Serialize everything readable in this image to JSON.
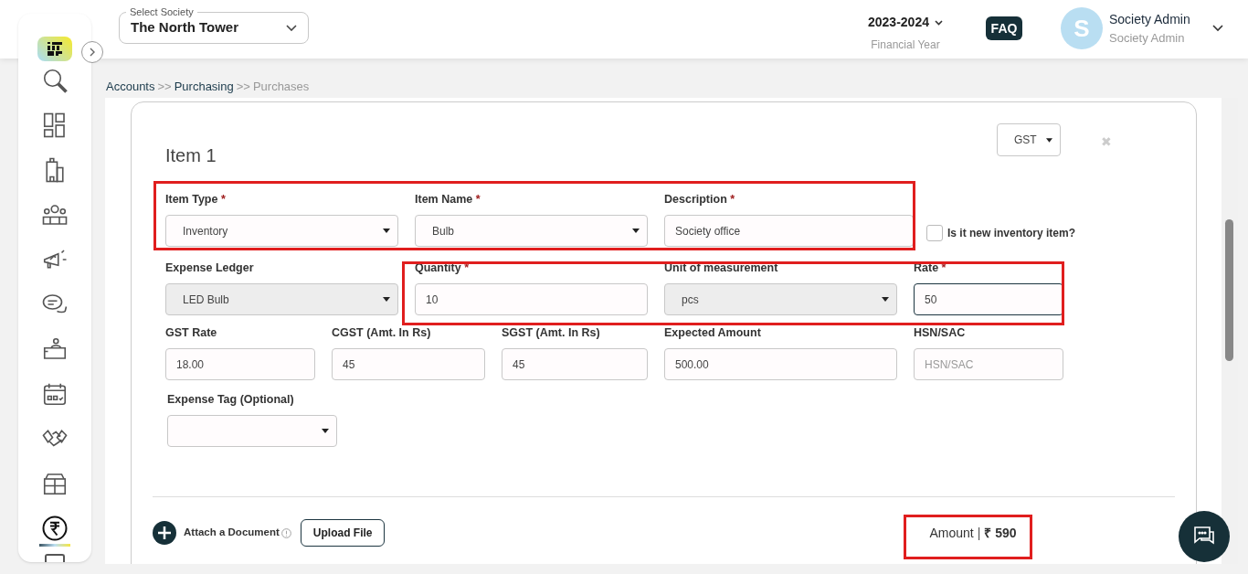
{
  "header": {
    "society_label": "Select Society",
    "society": "The North Tower",
    "year": "2023-2024",
    "year_caption": "Financial Year",
    "faq": "FAQ",
    "avatar_letter": "S",
    "user_name": "Society Admin",
    "user_role": "Society Admin"
  },
  "sidebar": {
    "items": [
      {
        "selected": false
      },
      {
        "selected": false
      },
      {
        "selected": false
      },
      {
        "selected": false
      },
      {
        "selected": false
      },
      {
        "selected": false
      },
      {
        "selected": false
      },
      {
        "selected": false
      },
      {
        "selected": false
      },
      {
        "selected": false
      },
      {
        "selected": true
      }
    ]
  },
  "breadcrumb": [
    {
      "kind": "link",
      "text": "Accounts"
    },
    {
      "kind": "separator",
      "text": ">>"
    },
    {
      "kind": "link",
      "text": "Purchasing"
    },
    {
      "kind": "separator",
      "text": ">>"
    },
    {
      "kind": "current",
      "text": "Purchases"
    }
  ],
  "item": {
    "title": "Item 1",
    "tax_type": "GST",
    "close": "✖",
    "fields": [
      {
        "kind": "select",
        "label": "Item Type",
        "required_mark": "*",
        "value": "Inventory",
        "disabled": false
      },
      {
        "kind": "select",
        "label": "Item Name",
        "required_mark": "*",
        "value": "Bulb",
        "disabled": false
      },
      {
        "kind": "input",
        "label": "Description",
        "required_mark": "*",
        "value": "Society office",
        "disabled": false
      },
      {
        "kind": "select",
        "label": "Expense Ledger",
        "value": "LED Bulb",
        "disabled": true
      },
      {
        "kind": "input",
        "label": "Quantity",
        "required_mark": "*",
        "value": "10",
        "disabled": false
      },
      {
        "kind": "select",
        "label": "Unit of measurement",
        "value": "pcs",
        "disabled": true
      },
      {
        "kind": "input",
        "label": "Rate",
        "required_mark": "*",
        "value": "50",
        "disabled": false,
        "focused": true
      },
      {
        "kind": "input",
        "label": "GST Rate",
        "value": "18.00",
        "disabled": false
      },
      {
        "kind": "input",
        "label": "CGST (Amt. In Rs)",
        "value": "45",
        "disabled": false
      },
      {
        "kind": "input",
        "label": "SGST (Amt. In Rs)",
        "value": "45",
        "disabled": false
      },
      {
        "kind": "input",
        "label": "Expected Amount",
        "value": "500.00",
        "disabled": false
      },
      {
        "kind": "input",
        "label": "HSN/SAC",
        "placeholder": "HSN/SAC",
        "disabled": false
      },
      {
        "kind": "select",
        "label": "Expense Tag (Optional)",
        "disabled": false
      }
    ],
    "new_inventory": {
      "label": "Is it new inventory item?",
      "checked": false
    },
    "attach_label": "Attach a Document",
    "upload": "Upload File",
    "amount_label": "Amount",
    "amount_divider": "|",
    "amount_value": "₹ 590"
  }
}
